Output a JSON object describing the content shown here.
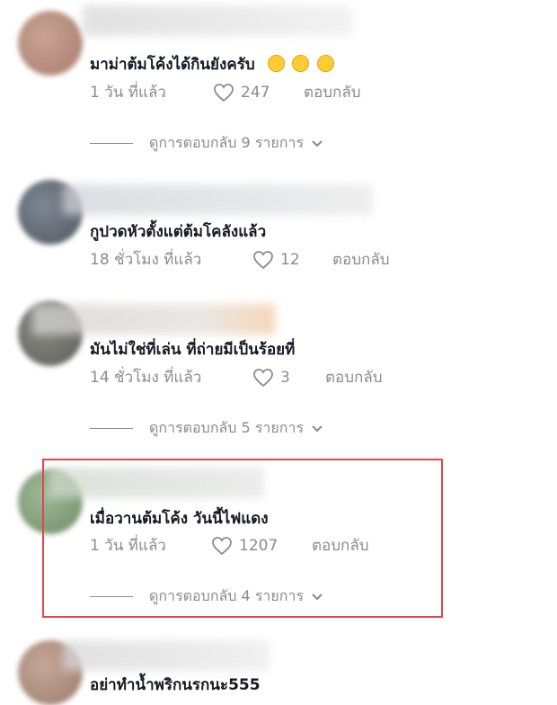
{
  "comments": [
    {
      "text": "มาม่าต้มโค้งได้กินยังครับ",
      "emojis": [
        "laughing-face",
        "hand-over-mouth-face",
        "grinning-face"
      ],
      "time": "1 วัน ที่แล้ว",
      "likes": "247",
      "reply": "ตอบกลับ",
      "view_replies": "ดูการตอบกลับ 9 รายการ"
    },
    {
      "text": "กูปวดหัวตั้งแต่ต้มโคลังแล้ว",
      "time": "18 ชั่วโมง ที่แล้ว",
      "likes": "12",
      "reply": "ตอบกลับ"
    },
    {
      "text": "มันไม่ใช่ที่เล่น ที่ถ่ายมีเป็นร้อยที่",
      "time": "14 ชั่วโมง ที่แล้ว",
      "likes": "3",
      "reply": "ตอบกลับ",
      "view_replies": "ดูการตอบกลับ 5 รายการ"
    },
    {
      "text": "เมื่อวานต้มโค้ง วันนี้ไฟแดง",
      "time": "1 วัน ที่แล้ว",
      "likes": "1207",
      "reply": "ตอบกลับ",
      "view_replies": "ดูการตอบกลับ 4 รายการ",
      "highlighted": true
    },
    {
      "text": "อย่าทำน้ำพริกนรกนะ555"
    }
  ],
  "colors": {
    "highlight_border": "#e0474c",
    "meta_text": "#8a8b91",
    "comment_text": "#161823"
  }
}
